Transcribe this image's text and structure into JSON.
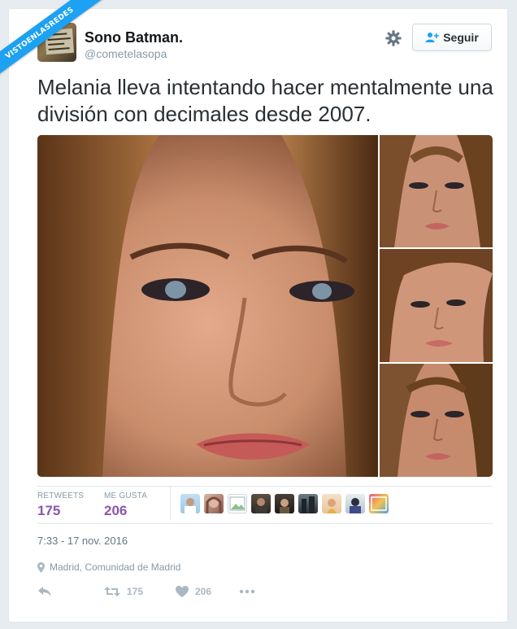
{
  "watermark": {
    "text": "VISTOENLASREDES"
  },
  "author": {
    "name": "Sono Batman.",
    "handle": "@cometelasopa",
    "avatar_icon": "avatar-photo-sign"
  },
  "header": {
    "settings_icon": "gear-icon",
    "follow_label": "Seguir",
    "follow_icon": "add-user-icon"
  },
  "tweet": {
    "text": "Melania lleva intentando hacer mentalmente una división con decimales desde 2007."
  },
  "media": {
    "photo_count": 4
  },
  "stats": {
    "retweets_label": "RETWEETS",
    "retweets_value": "175",
    "likes_label": "ME GUSTA",
    "likes_value": "206",
    "liker_count": 9
  },
  "meta": {
    "timestamp": "7:33 - 17 nov. 2016",
    "location": "Madrid, Comunidad de Madrid",
    "location_icon": "location-pin-icon"
  },
  "actions": {
    "reply_icon": "reply-icon",
    "retweet_icon": "retweet-icon",
    "retweet_count": "175",
    "like_icon": "heart-icon",
    "like_count": "206",
    "more_icon": "more-dots-icon"
  },
  "colors": {
    "accent_purple": "#8a56ac",
    "twitter_blue": "#1da1f2",
    "muted_gray": "#8899a6",
    "border": "#e1e8ed"
  }
}
